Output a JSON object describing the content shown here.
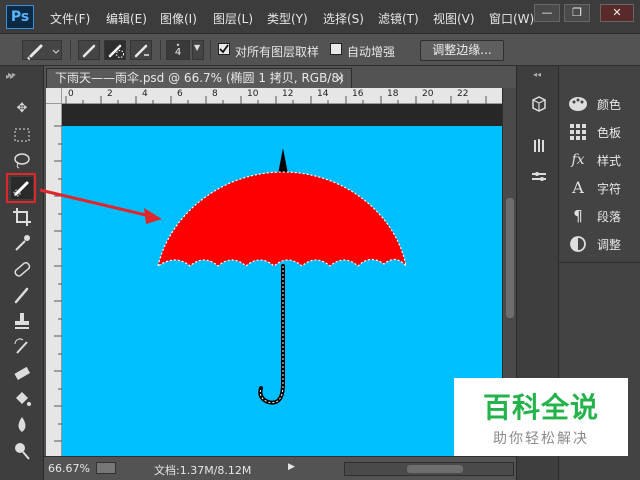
{
  "app": {
    "logo": "Ps"
  },
  "menu": {
    "items": [
      "文件(F)",
      "编辑(E)",
      "图像(I)",
      "图层(L)",
      "类型(Y)",
      "选择(S)",
      "滤镜(T)",
      "视图(V)",
      "窗口(W)"
    ]
  },
  "window_controls": {
    "minimize": "—",
    "restore": "❐",
    "close": "✕"
  },
  "options": {
    "brush_size": "4",
    "sample_all_layers": {
      "label": "对所有图层取样",
      "checked": true
    },
    "auto_enhance": {
      "label": "自动增强",
      "checked": false
    },
    "refine_edge_label": "调整边缘..."
  },
  "document": {
    "tab_title": "下雨天——雨伞.psd @ 66.7% (椭圆 1 拷贝, RGB/8)",
    "close": "×",
    "ruler_ticks": [
      "0",
      "2",
      "4",
      "6",
      "8",
      "10",
      "12",
      "14",
      "16",
      "18",
      "20",
      "22"
    ],
    "canvas_color": "#00bfff",
    "umbrella_color": "#ff0000",
    "handle_color": "#000000"
  },
  "status": {
    "zoom": "66.67%",
    "doc_size": "文档:1.37M/8.12M"
  },
  "panels": [
    {
      "icon": "palette-icon",
      "label": "颜色"
    },
    {
      "icon": "swatches-icon",
      "label": "色板"
    },
    {
      "icon": "styles-icon",
      "label": "样式"
    },
    {
      "icon": "character-icon",
      "label": "字符"
    },
    {
      "icon": "paragraph-icon",
      "label": "段落"
    },
    {
      "icon": "adjustments-icon",
      "label": "调整"
    }
  ],
  "watermark": {
    "title": "百科全说",
    "subtitle": "助你轻松解决"
  },
  "colors": {
    "accent_highlight": "#e0262b",
    "watermark_green": "#24b24a"
  }
}
